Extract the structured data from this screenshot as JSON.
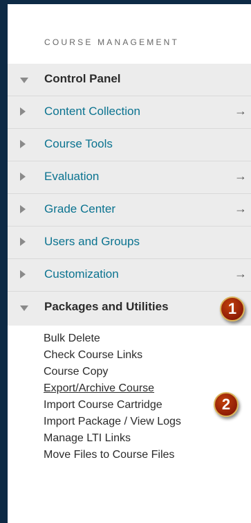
{
  "section_heading": "COURSE MANAGEMENT",
  "menu": [
    {
      "label": "Control Panel",
      "expanded": true,
      "bold": true,
      "has_arrow": false
    },
    {
      "label": "Content Collection",
      "expanded": false,
      "bold": false,
      "has_arrow": true
    },
    {
      "label": "Course Tools",
      "expanded": false,
      "bold": false,
      "has_arrow": false
    },
    {
      "label": "Evaluation",
      "expanded": false,
      "bold": false,
      "has_arrow": true
    },
    {
      "label": "Grade Center",
      "expanded": false,
      "bold": false,
      "has_arrow": true
    },
    {
      "label": "Users and Groups",
      "expanded": false,
      "bold": false,
      "has_arrow": false
    },
    {
      "label": "Customization",
      "expanded": false,
      "bold": false,
      "has_arrow": true
    },
    {
      "label": "Packages and Utilities",
      "expanded": true,
      "bold": true,
      "has_arrow": false
    }
  ],
  "arrow_glyph": "→",
  "packages_items": [
    "Bulk Delete",
    "Check Course Links",
    "Course Copy",
    "Export/Archive Course",
    "Import Course Cartridge",
    "Import Package / View Logs",
    "Manage LTI Links",
    "Move Files to Course Files"
  ],
  "badges": [
    "1",
    "2"
  ],
  "colors": {
    "frame": "#0d2a45",
    "link": "#0b7390",
    "band": "#ececec",
    "badge": "#a5290a"
  }
}
